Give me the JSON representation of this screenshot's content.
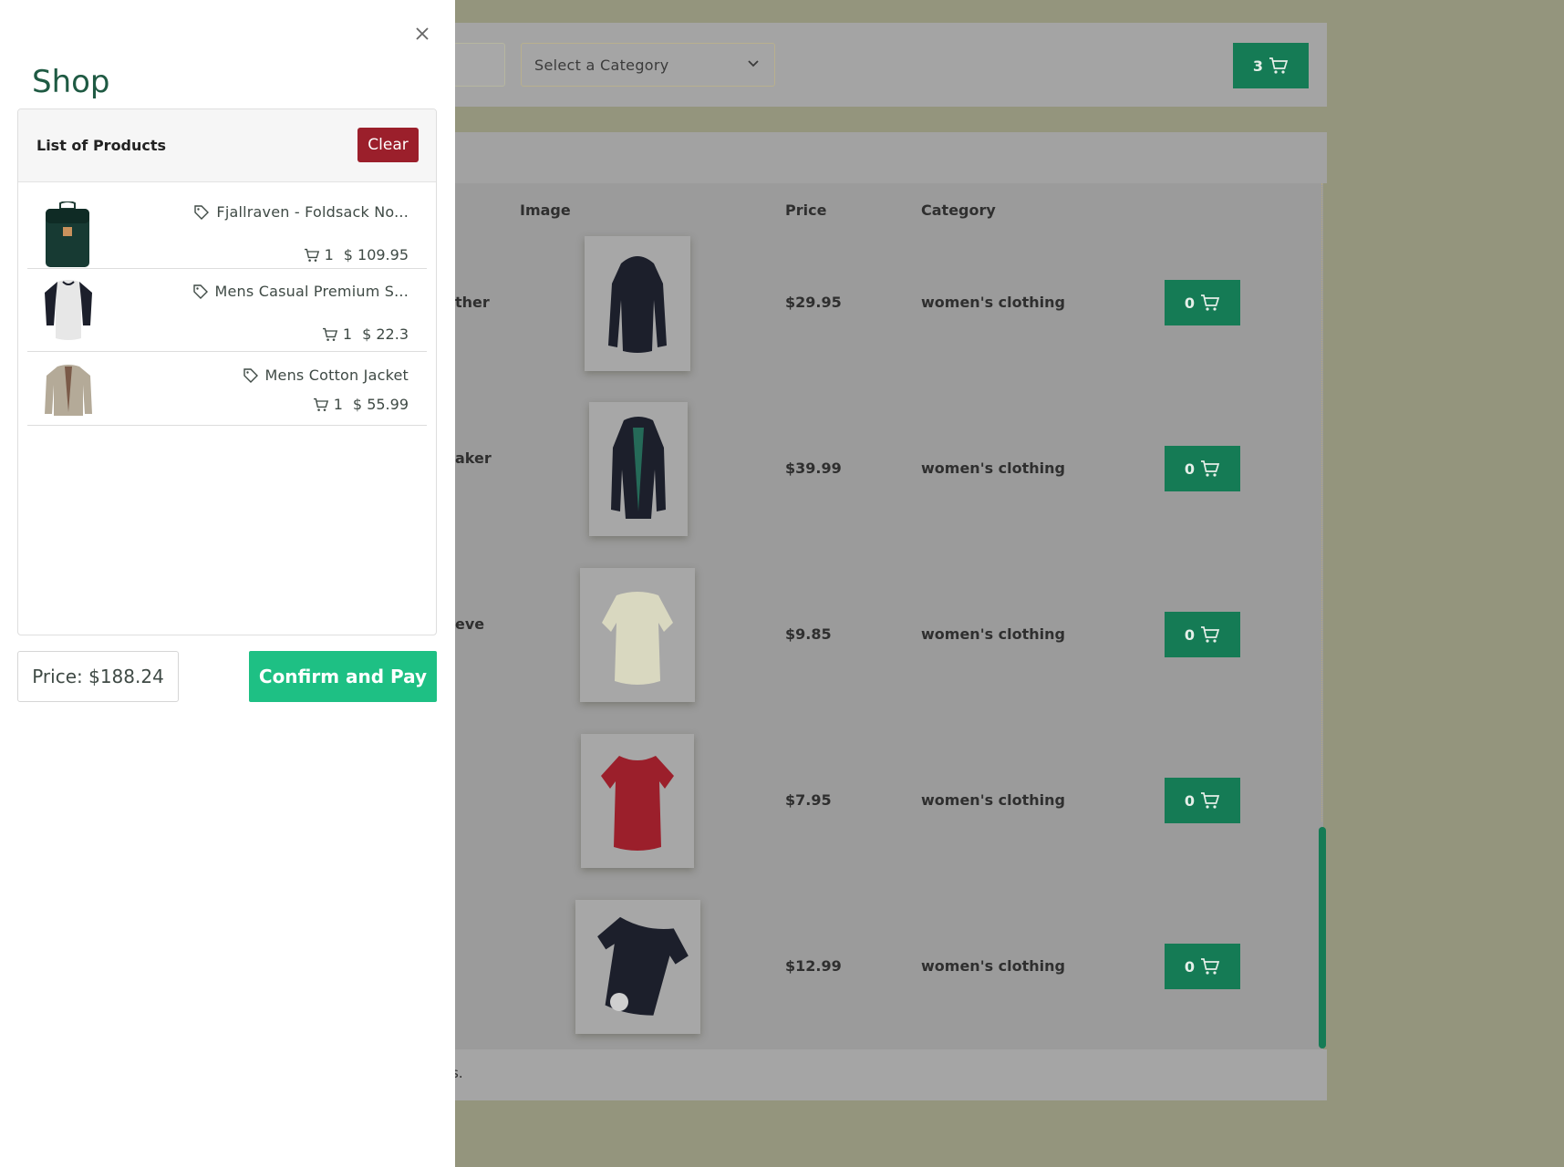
{
  "background": {
    "category_select": {
      "value": "Select a Category"
    },
    "cart_button": {
      "count": "3"
    },
    "table": {
      "headers": {
        "image": "Image",
        "price": "Price",
        "category": "Category"
      },
      "rows": [
        {
          "title_fragment": "ther",
          "price": "$29.95",
          "category": "women's clothing",
          "cart_count": "0"
        },
        {
          "title_fragment": "aker",
          "price": "$39.99",
          "category": "women's clothing",
          "cart_count": "0"
        },
        {
          "title_fragment": "eve",
          "price": "$9.85",
          "category": "women's clothing",
          "cart_count": "0"
        },
        {
          "title_fragment": "",
          "price": "$7.95",
          "category": "women's clothing",
          "cart_count": "0"
        },
        {
          "title_fragment": "",
          "price": "$12.99",
          "category": "women's clothing",
          "cart_count": "0"
        }
      ],
      "footer_fragment": "s."
    },
    "colors": {
      "accent": "#157b55",
      "overlay": "#94957d"
    }
  },
  "drawer": {
    "title": "Shop",
    "list": {
      "heading": "List of Products",
      "clear_label": "Clear",
      "items": [
        {
          "name": "Fjallraven - Foldsack No...",
          "qty": "1",
          "price": "$ 109.95"
        },
        {
          "name": "Mens Casual Premium S...",
          "qty": "1",
          "price": "$ 22.3"
        },
        {
          "name": "Mens Cotton Jacket",
          "qty": "1",
          "price": "$ 55.99"
        }
      ]
    },
    "total_price": "Price: $188.24",
    "pay_label": "Confirm and Pay",
    "colors": {
      "title": "#1f5a43",
      "clear": "#9b1f2b",
      "pay": "#1ec084"
    }
  }
}
